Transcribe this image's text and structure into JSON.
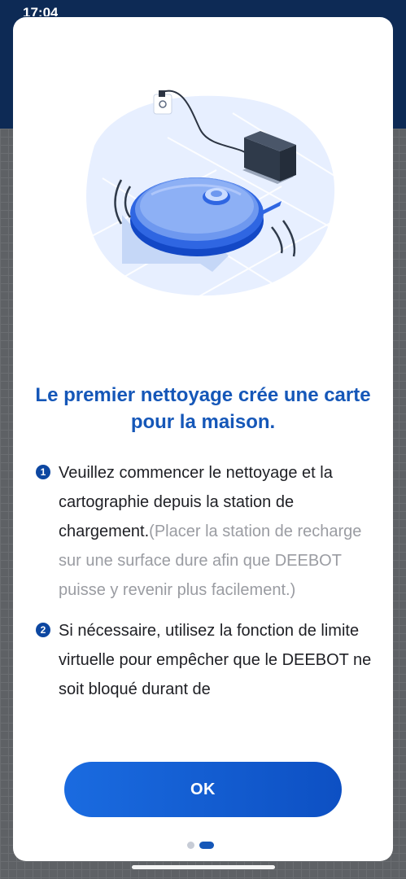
{
  "status_bar": {
    "time": "17:04"
  },
  "modal": {
    "title": "Le premier nettoyage crée une carte pour la maison.",
    "steps": [
      {
        "number": "1",
        "text": "Veuillez commencer le nettoyage et la cartographie depuis la station de chargement.",
        "note": "(Placer la station de recharge sur une surface dure afin que DEEBOT puisse y revenir plus facilement.)"
      },
      {
        "number": "2",
        "text": "Si nécessaire, utilisez la fonction de limite virtuelle pour empêcher que le DEEBOT ne soit bloqué durant de"
      }
    ],
    "ok_button": "OK",
    "pager": {
      "total": 2,
      "current": 2
    }
  },
  "icons": [
    "robot-vacuum-illustration",
    "charging-station-icon",
    "wall-outlet-icon",
    "navigation-arrow-icon"
  ],
  "colors": {
    "accent": "#1557b8",
    "button": "#1a6be0",
    "header": "#0d2a55",
    "battery": "#f0c400"
  }
}
